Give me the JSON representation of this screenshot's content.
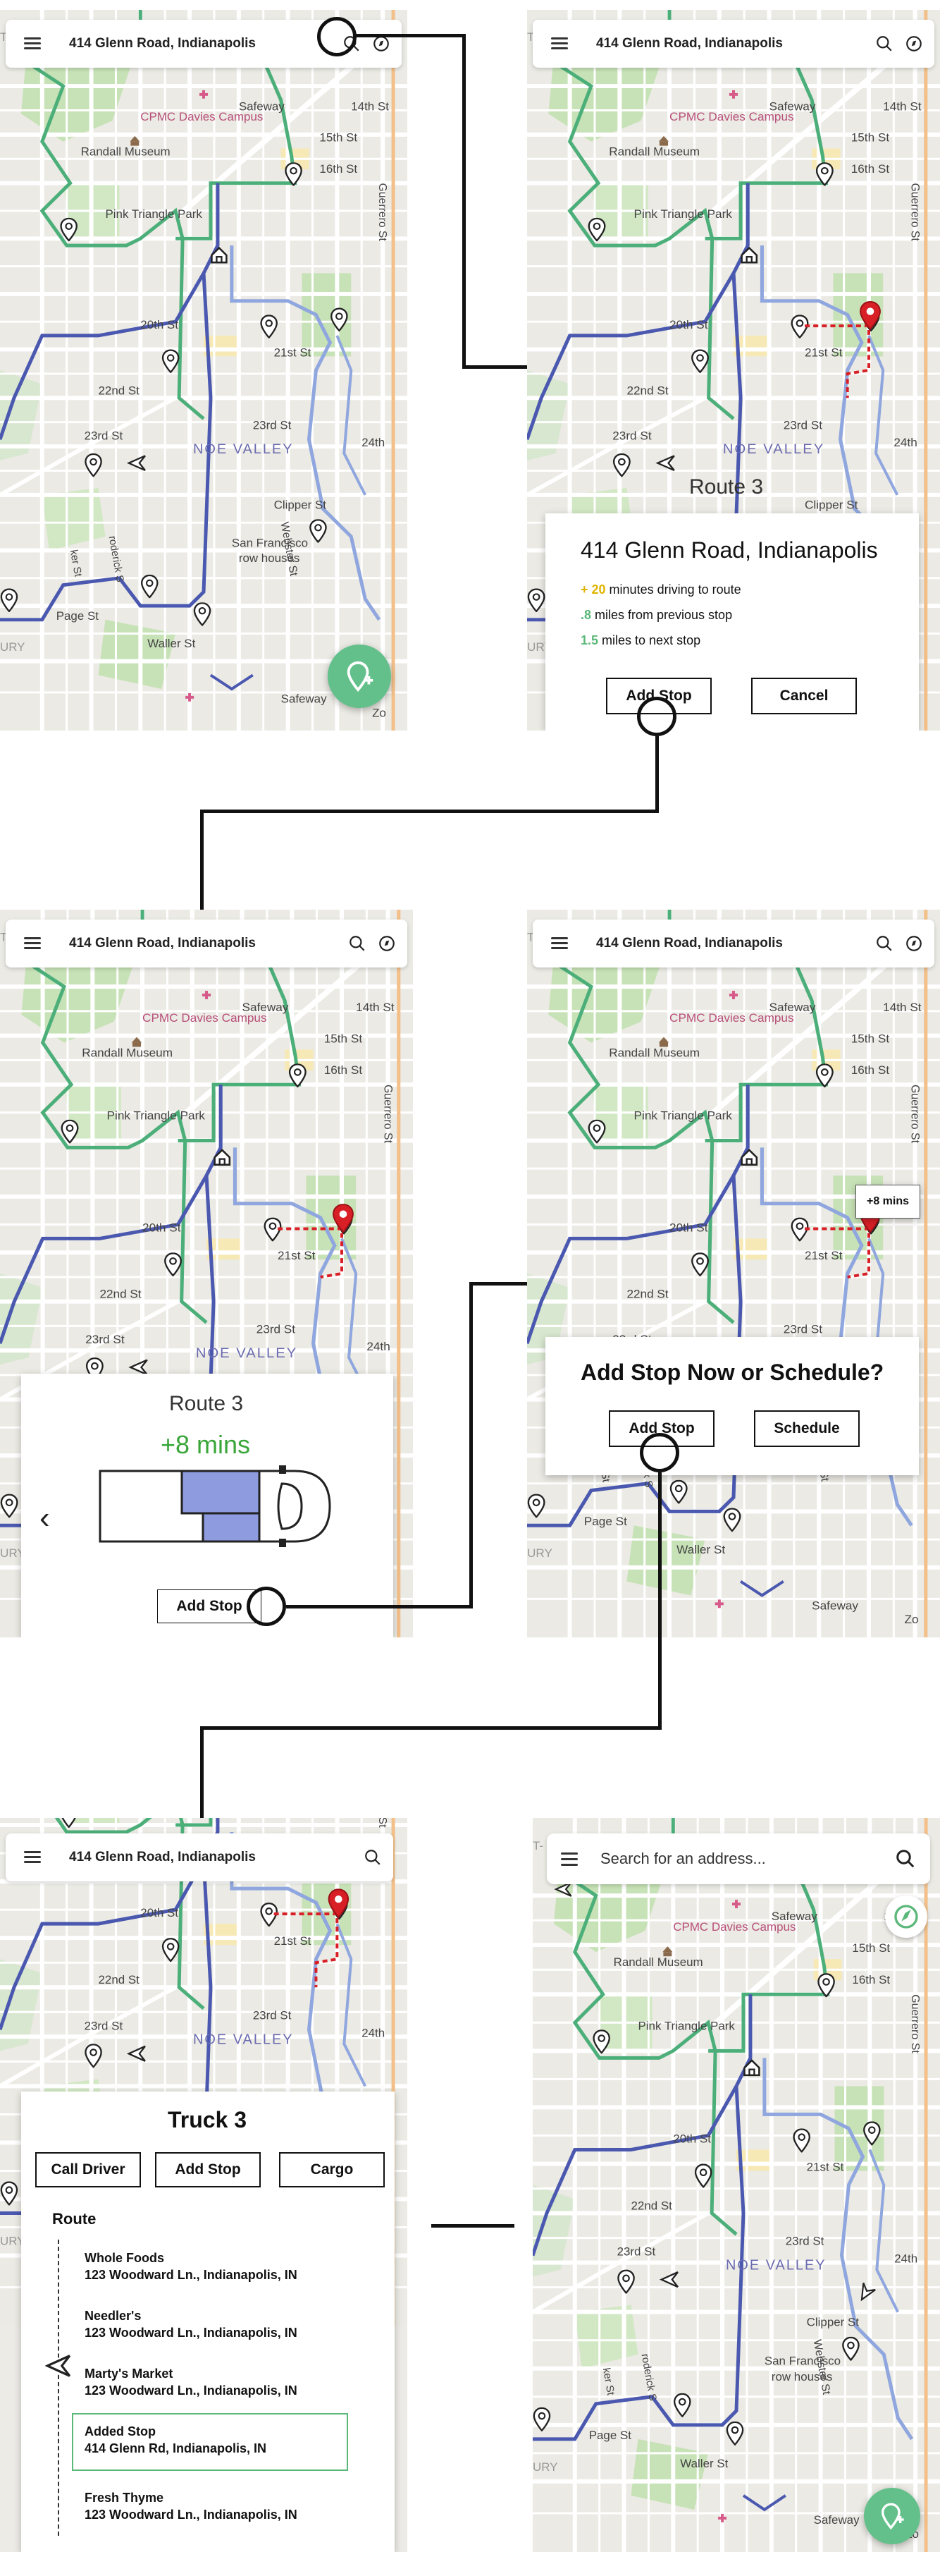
{
  "address": "414 Glenn Road, Indianapolis",
  "map_labels": {
    "cpmc": "CPMC Davies Campus",
    "safeway": "Safeway",
    "st14": "14th St",
    "st15": "15th St",
    "st16": "16th St",
    "randall": "Randall Museum",
    "pink": "Pink Triangle Park",
    "guerrero": "Guerrero St",
    "st20": "20th St",
    "st21": "21st St",
    "st22": "22nd St",
    "st23": "23rd St",
    "st24": "24th",
    "noe": "NOE VALLEY",
    "clipper": "Clipper St",
    "sfrow": "San Francisco",
    "sfrow2": "row houses",
    "webster": "Webster St",
    "page": "Page St",
    "waller": "Waller St",
    "roderick": "roderick S",
    "ker": "ker St",
    "ury": "URY"
  },
  "screen1": {},
  "screen2": {
    "route_label": "Route 3",
    "title": "414 Glenn Road, Indianapolis",
    "line1_prefix": "+ 20",
    "line1_rest": " minutes driving to route",
    "line2_prefix": ".8",
    "line2_rest": " miles from previous stop",
    "line3_prefix": "1.5",
    "line3_rest": " miles to next stop",
    "add_stop": "Add Stop",
    "cancel": "Cancel"
  },
  "screen3": {
    "route_title": "Route 3",
    "delta": "+8 mins",
    "back_chevron": "‹",
    "add_stop": "Add Stop"
  },
  "screen4": {
    "badge": "+8 mins",
    "question": "Add Stop Now or Schedule?",
    "add_stop": "Add Stop",
    "schedule": "Schedule"
  },
  "screen5": {
    "truck_title": "Truck 3",
    "call_driver": "Call Driver",
    "add_stop": "Add Stop",
    "cargo": "Cargo",
    "route_heading": "Route",
    "stops": [
      {
        "name": "Whole Foods",
        "address": "123 Woodward Ln., Indianapolis, IN"
      },
      {
        "name": "Needler's",
        "address": "123 Woodward Ln., Indianapolis, IN"
      },
      {
        "name": "Marty's Market",
        "address": "123 Woodward Ln., Indianapolis, IN"
      },
      {
        "name": "Added Stop",
        "address": "414 Glenn Rd, Indianapolis, IN"
      },
      {
        "name": "Fresh Thyme",
        "address": "123 Woodward Ln., Indianapolis, IN"
      }
    ]
  },
  "screen6": {
    "search_placeholder": "Search for an address..."
  },
  "colors": {
    "route_green": "#4caf7a",
    "route_blue": "#4a58b0",
    "route_lightblue": "#8fa6de",
    "marker_red": "#d81f26",
    "accent_yellow": "#e0b400",
    "accent_green": "#5cb87a",
    "truck_fill": "#8e9bdf",
    "fab_green": "#63c08a"
  },
  "icons": [
    "menu-icon",
    "search-icon",
    "compass-icon",
    "add-location-icon",
    "map-pin-icon",
    "home-icon",
    "navigation-arrow-icon",
    "truck-icon",
    "chevron-left-icon"
  ]
}
